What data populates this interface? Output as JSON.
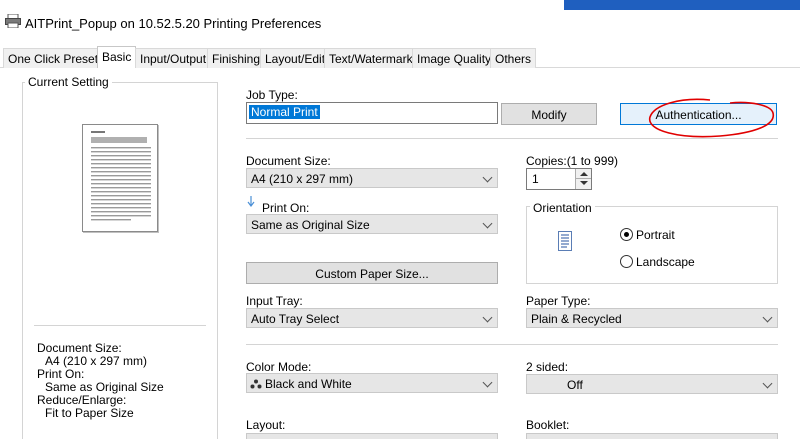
{
  "window": {
    "title": "AITPrint_Popup on 10.52.5.20 Printing Preferences"
  },
  "tabs": [
    {
      "label": "One Click Presets",
      "active": false
    },
    {
      "label": "Basic",
      "active": true
    },
    {
      "label": "Input/Output",
      "active": false
    },
    {
      "label": "Finishing",
      "active": false
    },
    {
      "label": "Layout/Edit",
      "active": false
    },
    {
      "label": "Text/Watermark",
      "active": false
    },
    {
      "label": "Image Quality",
      "active": false
    },
    {
      "label": "Others",
      "active": false
    }
  ],
  "current_setting": {
    "legend": "Current Setting",
    "summary": [
      "Document Size:",
      "A4 (210 x 297 mm)",
      "Print On:",
      "Same as Original Size",
      "Reduce/Enlarge:",
      "Fit to Paper Size"
    ]
  },
  "job_type": {
    "label": "Job Type:",
    "value": "Normal Print",
    "modify_label": "Modify",
    "auth_label": "Authentication..."
  },
  "document_size": {
    "label": "Document Size:",
    "value": "A4 (210 x 297 mm)"
  },
  "copies": {
    "label": "Copies:(1 to 999)",
    "value": "1"
  },
  "print_on": {
    "label": "Print On:",
    "value": "Same as Original Size"
  },
  "orientation": {
    "legend": "Orientation",
    "portrait_label": "Portrait",
    "landscape_label": "Landscape",
    "selected": "Portrait"
  },
  "custom_paper": {
    "label": "Custom Paper Size..."
  },
  "input_tray": {
    "label": "Input Tray:",
    "value": "Auto Tray Select"
  },
  "paper_type": {
    "label": "Paper Type:",
    "value": "Plain & Recycled"
  },
  "color_mode": {
    "label": "Color Mode:",
    "value": "Black and White"
  },
  "two_sided": {
    "label": "2 sided:",
    "value": "Off"
  },
  "layout": {
    "label": "Layout:"
  },
  "booklet": {
    "label": "Booklet:"
  },
  "colors": {
    "accent": "#0078d7",
    "annotation": "#e00000"
  }
}
